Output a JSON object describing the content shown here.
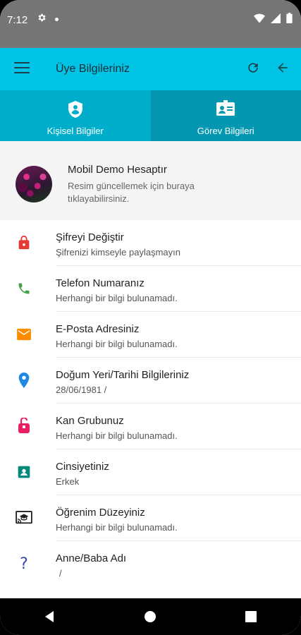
{
  "status": {
    "time": "7:12"
  },
  "appbar": {
    "title": "Üye Bilgileriniz"
  },
  "tabs": [
    {
      "label": "Kişisel Bilgiler",
      "icon": "shield-person-icon",
      "active": true
    },
    {
      "label": "Görev Bilgileri",
      "icon": "id-card-icon",
      "active": false
    }
  ],
  "profile": {
    "name": "Mobil Demo Hesaptır",
    "hint": "Resim güncellemek için buraya tıklayabilirsiniz."
  },
  "items": [
    {
      "title": "Şifreyi Değiştir",
      "subtitle": "Şifrenizi kimseyle paylaşmayın",
      "icon": "lock-icon",
      "color": "#e53935"
    },
    {
      "title": "Telefon Numaranız",
      "subtitle": "Herhangi bir bilgi bulunamadı.",
      "icon": "phone-icon",
      "color": "#43a047"
    },
    {
      "title": "E-Posta Adresiniz",
      "subtitle": "Herhangi bir bilgi bulunamadı.",
      "icon": "mail-icon",
      "color": "#fb8c00"
    },
    {
      "title": "Doğum Yeri/Tarihi Bilgileriniz",
      "subtitle": "28/06/1981 /",
      "icon": "location-pin-icon",
      "color": "#1e88e5"
    },
    {
      "title": "Kan Grubunuz",
      "subtitle": "Herhangi bir bilgi bulunamadı.",
      "icon": "blood-bag-icon",
      "color": "#e91e63"
    },
    {
      "title": "Cinsiyetiniz",
      "subtitle": "Erkek",
      "icon": "contact-card-icon",
      "color": "#00897b"
    },
    {
      "title": "Öğrenim Düzeyiniz",
      "subtitle": "Herhangi bir bilgi bulunamadı.",
      "icon": "cast-education-icon",
      "color": "#212121"
    },
    {
      "title": "Anne/Baba Adı",
      "subtitle": "/",
      "icon": "question-icon",
      "color": "#3949ab"
    }
  ]
}
